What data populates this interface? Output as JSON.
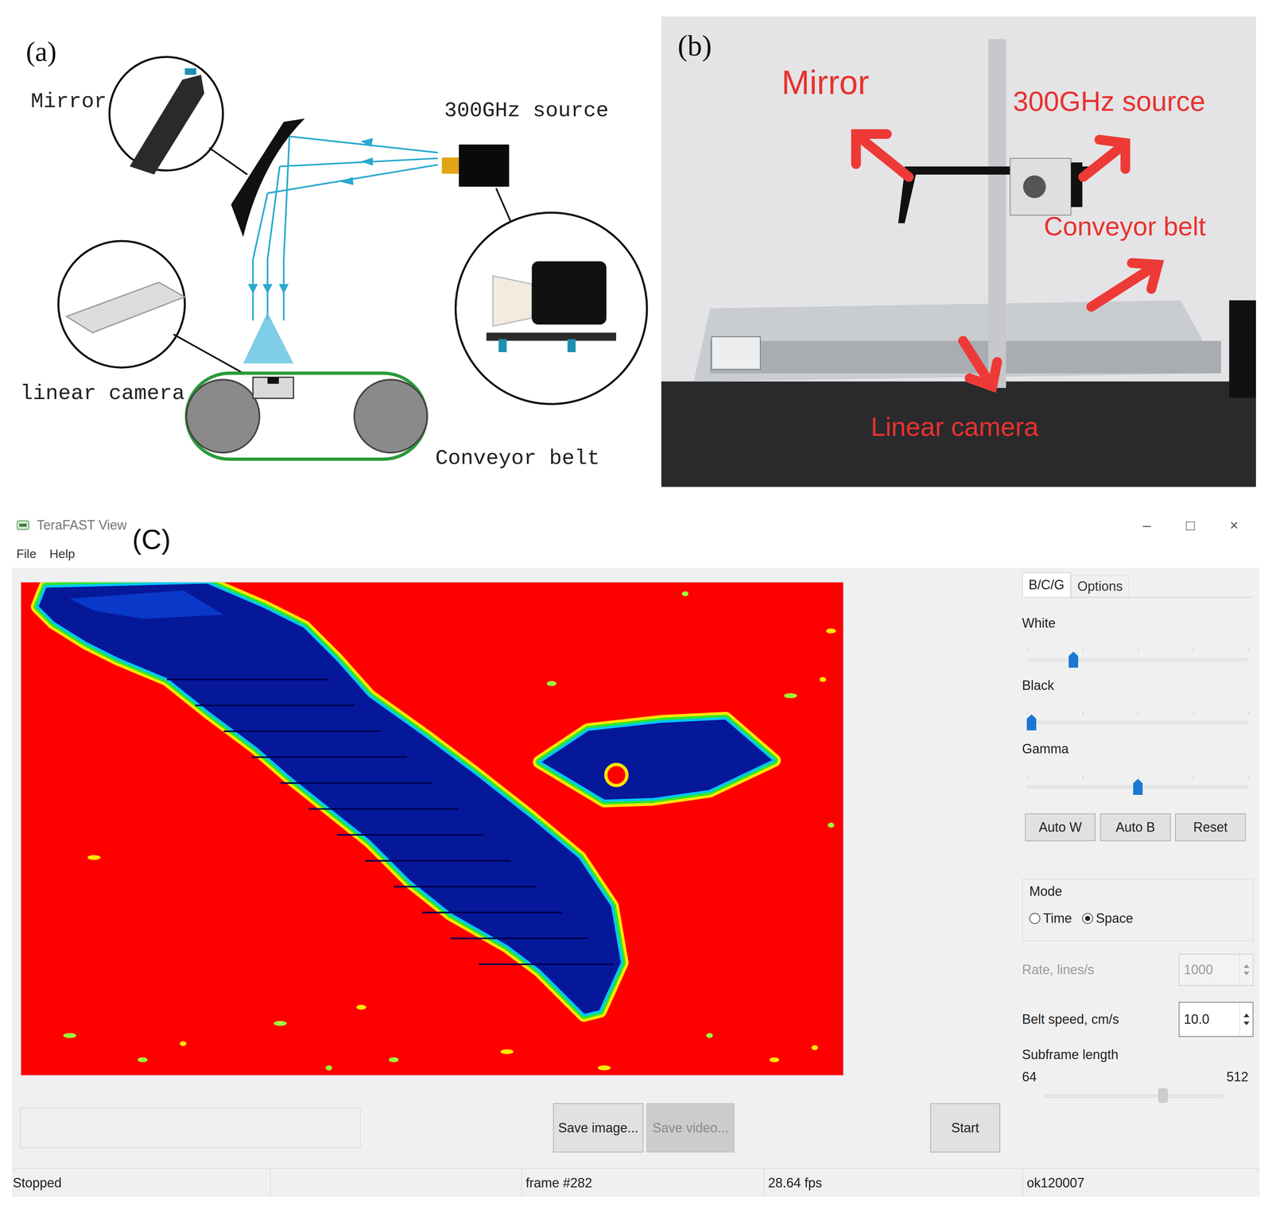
{
  "panel_a": {
    "label": "(a)",
    "mirror": "Mirror",
    "source": "300GHz source",
    "camera": "linear camera",
    "belt": "Conveyor belt"
  },
  "panel_b": {
    "label": "(b)",
    "mirror": "Mirror",
    "source": "300GHz source",
    "belt": "Conveyor belt",
    "camera": "Linear camera"
  },
  "panel_c": {
    "label": "(C)",
    "window": {
      "title": "TeraFAST View"
    },
    "window_controls": [
      "–",
      "□",
      "×"
    ],
    "menu": [
      "File",
      "Help"
    ],
    "tabs": [
      {
        "label": "B/C/G",
        "selected": true
      },
      {
        "label": "Options",
        "selected": false
      }
    ],
    "sliders": [
      {
        "label": "White",
        "level": 0.21
      },
      {
        "label": "Black",
        "level": 0.02
      },
      {
        "label": "Gamma",
        "level": 0.5
      }
    ],
    "auto_buttons": [
      "Auto W",
      "Auto B",
      "Reset"
    ],
    "mode": {
      "label": "Mode",
      "options": [
        {
          "label": "Time",
          "selected": false
        },
        {
          "label": "Space",
          "selected": true
        }
      ]
    },
    "rate": {
      "label": "Rate, lines/s",
      "value": "1000",
      "disabled": true
    },
    "belt_speed": {
      "label": "Belt speed, cm/s",
      "value": "10.0"
    },
    "subframe": {
      "label": "Subframe length",
      "min": "64",
      "max": "512",
      "level": 0.66
    },
    "buttons": [
      {
        "label": "Save image...",
        "disabled": false
      },
      {
        "label": "Save video...",
        "disabled": true
      },
      {
        "label": "Start",
        "disabled": false
      }
    ],
    "status_bar": [
      "Stopped",
      "frame #282",
      "28.64 fps",
      "ok120007"
    ]
  }
}
